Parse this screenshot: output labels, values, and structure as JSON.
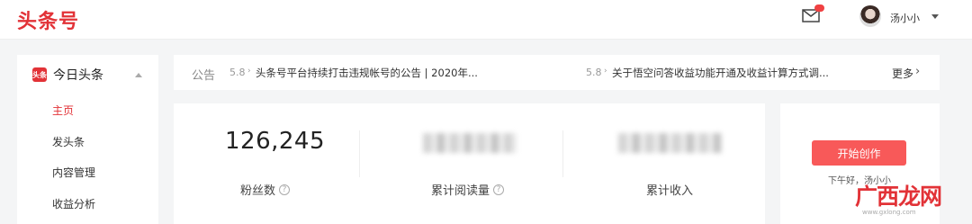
{
  "header": {
    "logo": "头条号",
    "username": "汤小小"
  },
  "sidebar": {
    "title": "今日头条",
    "logo_text": "头条",
    "items": [
      {
        "label": "主页",
        "active": true
      },
      {
        "label": "发头条",
        "active": false
      },
      {
        "label": "内容管理",
        "active": false
      },
      {
        "label": "收益分析",
        "active": false
      }
    ]
  },
  "notice": {
    "label": "公告",
    "items": [
      {
        "date": "5.8",
        "text": "头条号平台持续打击违规帐号的公告 | 2020年..."
      },
      {
        "date": "5.8",
        "text": "关于悟空问答收益功能开通及收益计算方式调..."
      }
    ],
    "more": "更多"
  },
  "stats": {
    "fans_value": "126,245",
    "fans_label": "粉丝数",
    "reads_label": "累计阅读量",
    "income_label": "累计收入"
  },
  "create": {
    "button": "开始创作",
    "greeting": "下午好，汤小小"
  },
  "watermark": {
    "text": "广西龙网",
    "url": "www.gxlong.com"
  },
  "colors": {
    "brand": "#e23237",
    "button": "#f85959"
  }
}
